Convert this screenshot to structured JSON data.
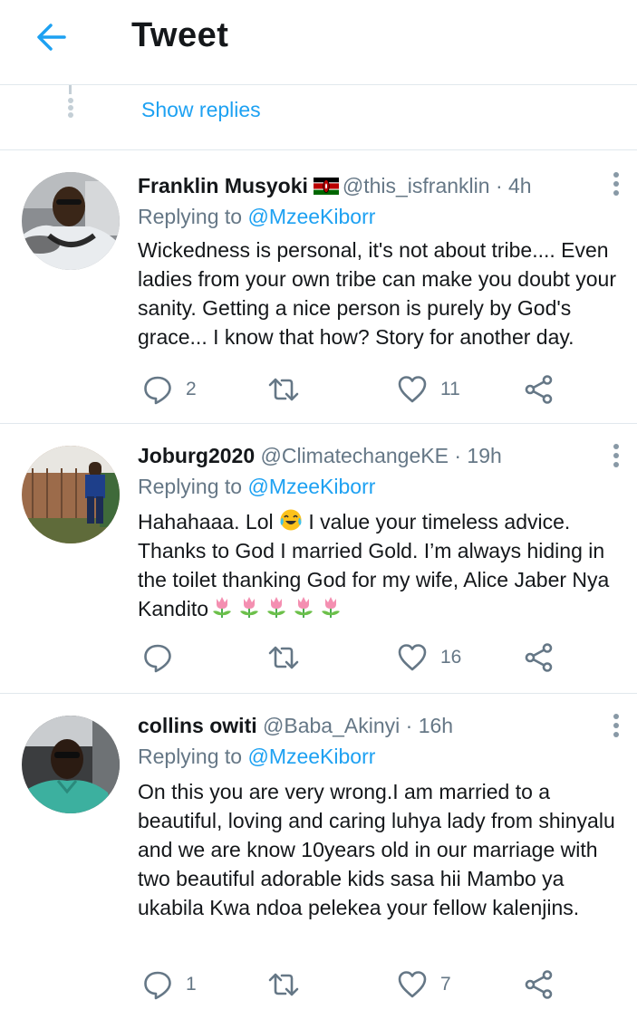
{
  "header": {
    "title": "Tweet"
  },
  "thread": {
    "show_replies_label": "Show replies"
  },
  "tweets": [
    {
      "display_name": "Franklin Musyoki",
      "handle": "@this_isfranklin",
      "time": "4h",
      "replying_prefix": "Replying to",
      "replying_to": "@MzeeKiborr",
      "text": "Wickedness is personal, it's not about tribe.... Even ladies from your own tribe can make you doubt your sanity. Getting a nice person is purely by God's grace... I know that how? Story for another day.",
      "replies": "2",
      "retweets": "",
      "likes": "11"
    },
    {
      "display_name": "Joburg2020",
      "handle": "@ClimatechangeKE",
      "time": "19h",
      "replying_prefix": "Replying to",
      "replying_to": "@MzeeKiborr",
      "text_line1_pre": "Hahahaaa.  Lol ",
      "text_line1_post": " I value your timeless advice.",
      "text_rest": "Thanks to God I married Gold. I’m always hiding in the toilet thanking God for my wife, Alice Jaber Nya Kandito",
      "replies": "",
      "retweets": "",
      "likes": "16"
    },
    {
      "display_name": "collins owiti",
      "handle": "@Baba_Akinyi",
      "time": "16h",
      "replying_prefix": "Replying to",
      "replying_to": "@MzeeKiborr",
      "text": "On this you are very wrong.I am married to a beautiful, loving and caring luhya lady from shinyalu and we are know 10years old in our marriage with two beautiful adorable kids sasa hii Mambo ya ukabila Kwa ndoa pelekea your fellow kalenjins.",
      "replies": "1",
      "retweets": "",
      "likes": "7"
    }
  ],
  "icons": {
    "back": "arrow-left-icon",
    "reply": "reply-icon",
    "retweet": "retweet-icon",
    "like": "heart-icon",
    "share": "share-icon",
    "more": "more-vertical-icon"
  },
  "colors": {
    "accent": "#1da1f2",
    "secondary_text": "#657786",
    "divider": "#e1e8ed"
  }
}
